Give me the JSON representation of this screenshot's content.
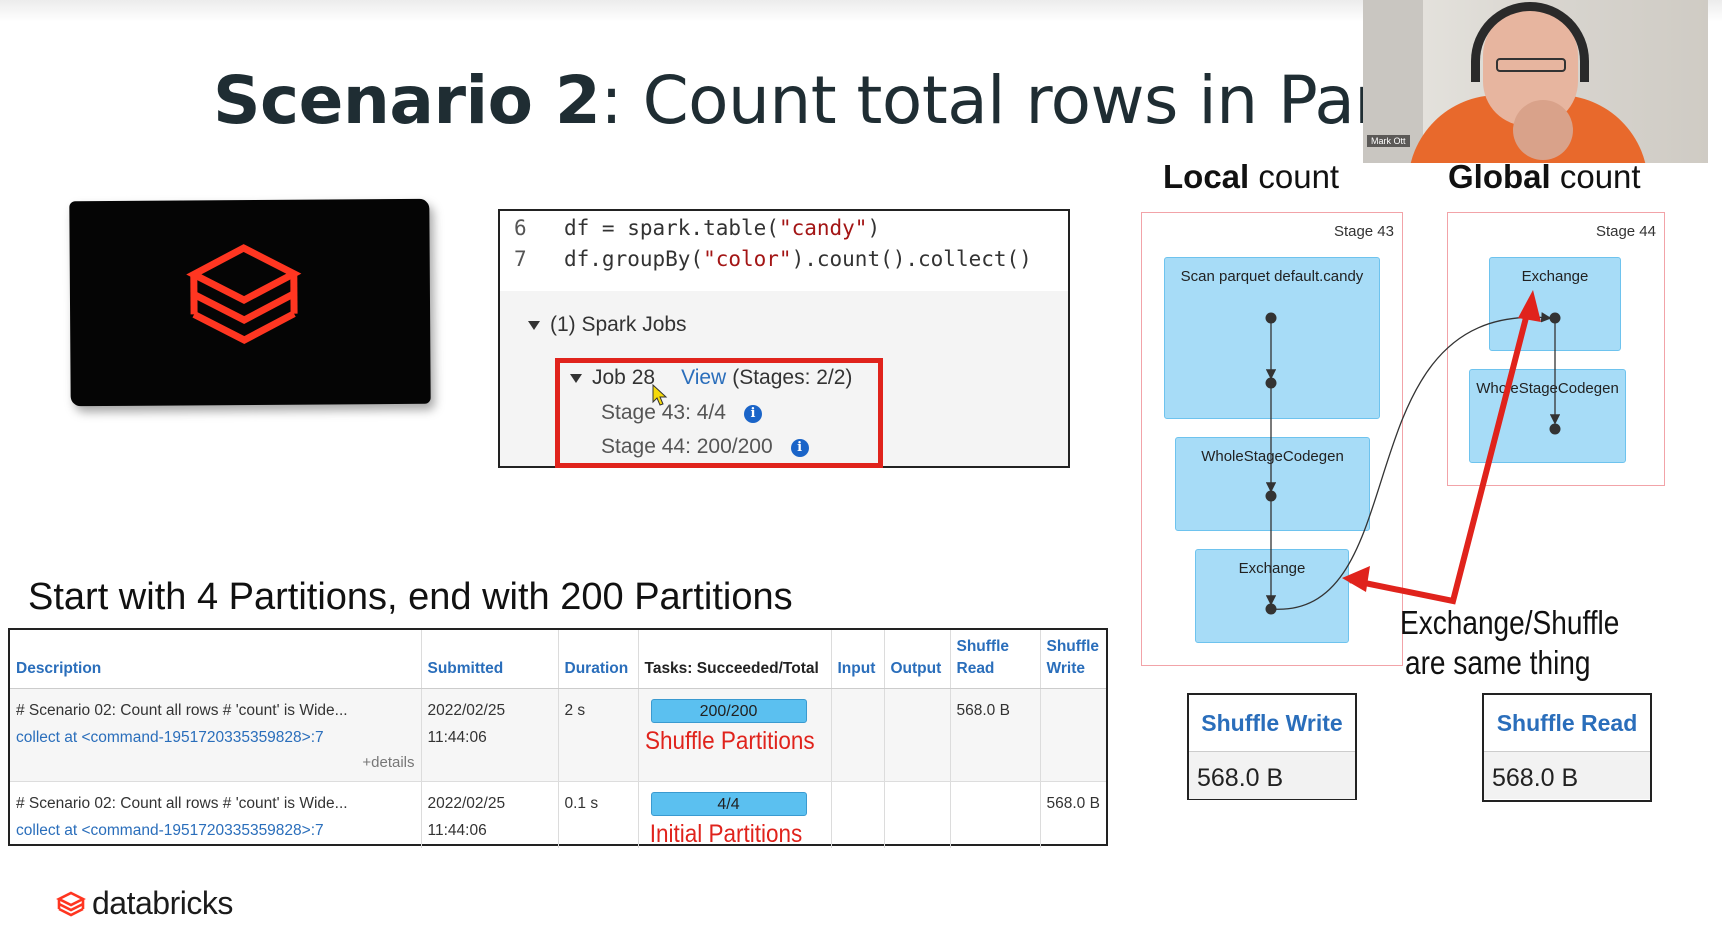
{
  "slide": {
    "title_bold": "Scenario 2",
    "title_rest": ": Count total rows in Partit"
  },
  "webcam": {
    "name": "Mark Ott"
  },
  "code": {
    "lines": [
      {
        "num": "6",
        "prefix": "df = spark.table(",
        "string": "\"candy\"",
        "suffix": ")"
      },
      {
        "num": "7",
        "prefix": "df.groupBy(",
        "string": "\"color\"",
        "suffix": ").count().collect()"
      }
    ]
  },
  "jobs": {
    "header": "(1) Spark Jobs",
    "job_label": "Job 28",
    "view_link": "View",
    "stages_summary": "(Stages: 2/2)",
    "stages": [
      "Stage 43: 4/4",
      "Stage 44: 200/200"
    ]
  },
  "partitions_title": "Start with 4 Partitions, end with 200 Partitions",
  "table": {
    "headers": [
      "Description",
      "Submitted",
      "Duration",
      "Tasks: Succeeded/Total",
      "Input",
      "Output",
      "Shuffle Read",
      "Shuffle Write"
    ],
    "rows": [
      {
        "description": "# Scenario 02: Count all rows # 'count' is Wide...",
        "link": "collect at <command-1951720335359828>:7",
        "details": "+details",
        "submitted_date": "2022/02/25",
        "submitted_time": "11:44:06",
        "duration": "2 s",
        "tasks": "200/200",
        "annotation": "Shuffle Partitions",
        "input": "",
        "output": "",
        "shuffle_read": "568.0 B",
        "shuffle_write": ""
      },
      {
        "description": "# Scenario 02: Count all rows # 'count' is Wide...",
        "link": "collect at <command-1951720335359828>:7",
        "submitted_date": "2022/02/25",
        "submitted_time": "11:44:06",
        "duration": "0.1 s",
        "tasks": "4/4",
        "annotation": "Initial Partitions",
        "input": "",
        "output": "",
        "shuffle_read": "",
        "shuffle_write": "568.0 B"
      }
    ]
  },
  "local_count": {
    "bold": "Local",
    "rest": " count",
    "stage": "Stage 43",
    "nodes": [
      "Scan parquet default.candy",
      "WholeStageCodegen",
      "Exchange"
    ]
  },
  "global_count": {
    "bold": "Global",
    "rest": " count",
    "stage": "Stage 44",
    "nodes": [
      "Exchange",
      "WholeStageCodegen"
    ]
  },
  "exchange_note": [
    "Exchange/Shuffle",
    "are same thing"
  ],
  "shuffle_write_card": {
    "title": "Shuffle Write",
    "value": "568.0 B"
  },
  "shuffle_read_card": {
    "title": "Shuffle Read",
    "value": "568.0 B"
  },
  "footer_logo": "databricks",
  "colors": {
    "accent_blue": "#2a6ebb",
    "highlight_red": "#e0231c",
    "brand_orange": "#ff3621",
    "node_blue": "#a7dcf7"
  }
}
